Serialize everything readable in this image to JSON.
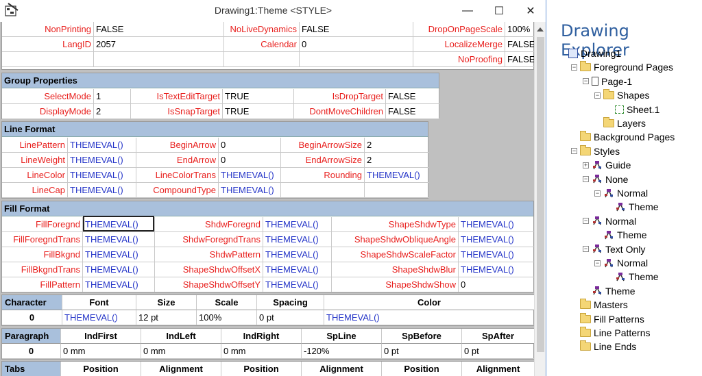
{
  "window": {
    "title": "Drawing1:Theme <STYLE>",
    "minimize": "—",
    "maximize": "☐",
    "close": "✕"
  },
  "misc": {
    "rows": [
      [
        {
          "n": "NonPrinting",
          "v": "FALSE"
        },
        {
          "n": "NoLiveDynamics",
          "v": "FALSE"
        },
        {
          "n": "DropOnPageScale",
          "v": "100%"
        }
      ],
      [
        {
          "n": "LangID",
          "v": "2057"
        },
        {
          "n": "Calendar",
          "v": "0"
        },
        {
          "n": "LocalizeMerge",
          "v": "FALSE"
        }
      ],
      [
        {
          "n": "",
          "v": ""
        },
        {
          "n": "",
          "v": ""
        },
        {
          "n": "NoProofing",
          "v": "FALSE"
        }
      ]
    ]
  },
  "group": {
    "title": "Group Properties",
    "rows": [
      [
        {
          "n": "SelectMode",
          "v": "1"
        },
        {
          "n": "IsTextEditTarget",
          "v": "TRUE"
        },
        {
          "n": "IsDropTarget",
          "v": "FALSE"
        }
      ],
      [
        {
          "n": "DisplayMode",
          "v": "2"
        },
        {
          "n": "IsSnapTarget",
          "v": "TRUE"
        },
        {
          "n": "DontMoveChildren",
          "v": "FALSE"
        }
      ]
    ]
  },
  "line": {
    "title": "Line Format",
    "rows": [
      [
        {
          "n": "LinePattern",
          "v": "THEMEVAL()"
        },
        {
          "n": "BeginArrow",
          "v": "0"
        },
        {
          "n": "BeginArrowSize",
          "v": "2"
        }
      ],
      [
        {
          "n": "LineWeight",
          "v": "THEMEVAL()"
        },
        {
          "n": "EndArrow",
          "v": "0"
        },
        {
          "n": "EndArrowSize",
          "v": "2"
        }
      ],
      [
        {
          "n": "LineColor",
          "v": "THEMEVAL()"
        },
        {
          "n": "LineColorTrans",
          "v": "THEMEVAL()"
        },
        {
          "n": "Rounding",
          "v": "THEMEVAL()"
        }
      ],
      [
        {
          "n": "LineCap",
          "v": "THEMEVAL()"
        },
        {
          "n": "CompoundType",
          "v": "THEMEVAL()"
        },
        {
          "n": "",
          "v": ""
        }
      ]
    ]
  },
  "fill": {
    "title": "Fill Format",
    "rows": [
      [
        {
          "n": "FillForegnd",
          "v": "THEMEVAL()"
        },
        {
          "n": "ShdwForegnd",
          "v": "THEMEVAL()"
        },
        {
          "n": "ShapeShdwType",
          "v": "THEMEVAL()"
        }
      ],
      [
        {
          "n": "FillForegndTrans",
          "v": "THEMEVAL()"
        },
        {
          "n": "ShdwForegndTrans",
          "v": "THEMEVAL()"
        },
        {
          "n": "ShapeShdwObliqueAngle",
          "v": "THEMEVAL()"
        }
      ],
      [
        {
          "n": "FillBkgnd",
          "v": "THEMEVAL()"
        },
        {
          "n": "ShdwPattern",
          "v": "THEMEVAL()"
        },
        {
          "n": "ShapeShdwScaleFactor",
          "v": "THEMEVAL()"
        }
      ],
      [
        {
          "n": "FillBkgndTrans",
          "v": "THEMEVAL()"
        },
        {
          "n": "ShapeShdwOffsetX",
          "v": "THEMEVAL()"
        },
        {
          "n": "ShapeShdwBlur",
          "v": "THEMEVAL()"
        }
      ],
      [
        {
          "n": "FillPattern",
          "v": "THEMEVAL()"
        },
        {
          "n": "ShapeShdwOffsetY",
          "v": "THEMEVAL()"
        },
        {
          "n": "ShapeShdwShow",
          "v": "0"
        }
      ]
    ]
  },
  "character": {
    "headers": [
      "Character",
      "Font",
      "Size",
      "Scale",
      "Spacing",
      "Color"
    ],
    "row": [
      "0",
      "THEMEVAL()",
      "12 pt",
      "100%",
      "0 pt",
      "THEMEVAL()"
    ]
  },
  "paragraph": {
    "headers": [
      "Paragraph",
      "IndFirst",
      "IndLeft",
      "IndRight",
      "SpLine",
      "SpBefore",
      "SpAfter"
    ],
    "row": [
      "0",
      "0 mm",
      "0 mm",
      "0 mm",
      "-120%",
      "0 pt",
      "0 pt"
    ]
  },
  "tabs": {
    "headers": [
      "Tabs",
      "Position",
      "Alignment",
      "Position",
      "Alignment",
      "Position",
      "Alignment"
    ]
  },
  "explorer": {
    "title": "Drawing Explorer",
    "nodes": [
      {
        "label": "Drawing1",
        "icon": "doc-icon",
        "exp": ""
      },
      {
        "label": "Foreground Pages",
        "icon": "folder-icon",
        "exp": "−"
      },
      {
        "label": "Page-1",
        "icon": "page-icon",
        "exp": "−"
      },
      {
        "label": "Shapes",
        "icon": "folder-icon",
        "exp": "−"
      },
      {
        "label": "Sheet.1",
        "icon": "shape-sheet-icon",
        "exp": ""
      },
      {
        "label": "Layers",
        "icon": "folder-icon",
        "exp": ""
      },
      {
        "label": "Background Pages",
        "icon": "folder-icon",
        "exp": ""
      },
      {
        "label": "Styles",
        "icon": "folder-icon",
        "exp": "−"
      },
      {
        "label": "Guide",
        "icon": "style-icon",
        "exp": "+"
      },
      {
        "label": "None",
        "icon": "style-icon",
        "exp": "−"
      },
      {
        "label": "Normal",
        "icon": "style-icon",
        "exp": "−"
      },
      {
        "label": "Theme",
        "icon": "style-icon",
        "exp": ""
      },
      {
        "label": "Normal",
        "icon": "style-icon",
        "exp": "−"
      },
      {
        "label": "Theme",
        "icon": "style-icon",
        "exp": ""
      },
      {
        "label": "Text Only",
        "icon": "style-icon",
        "exp": "−"
      },
      {
        "label": "Normal",
        "icon": "style-icon",
        "exp": "−"
      },
      {
        "label": "Theme",
        "icon": "style-icon",
        "exp": ""
      },
      {
        "label": "Theme",
        "icon": "style-icon",
        "exp": ""
      },
      {
        "label": "Masters",
        "icon": "folder-icon",
        "exp": ""
      },
      {
        "label": "Fill Patterns",
        "icon": "folder-icon",
        "exp": ""
      },
      {
        "label": "Line Patterns",
        "icon": "folder-icon",
        "exp": ""
      },
      {
        "label": "Line Ends",
        "icon": "folder-icon",
        "exp": ""
      }
    ]
  }
}
